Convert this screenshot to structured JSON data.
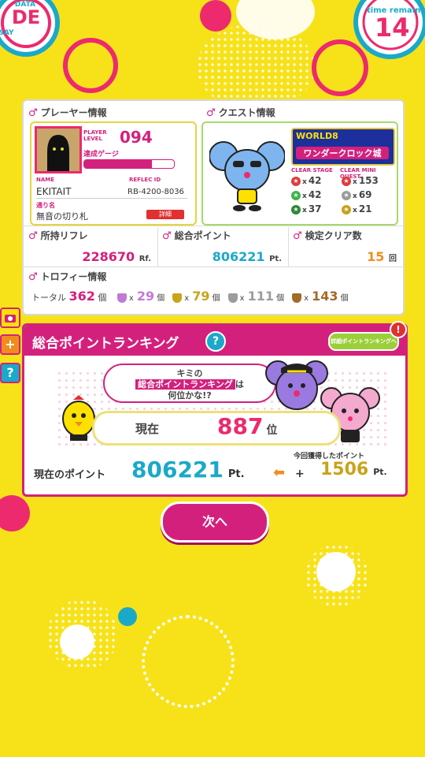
{
  "header": {
    "logo_text": "DATA SAY DE",
    "time_label": "time remain",
    "time_value": "14"
  },
  "player": {
    "section_title": "プレーヤー情報",
    "level_label": "PLAYER LEVEL",
    "level": "094",
    "gauge_label": "達成ゲージ",
    "gauge_fraction": 0.75,
    "name_label": "NAME",
    "name": "EKITAIT",
    "reflec_label": "REFLEC ID",
    "reflec_id": "RB-4200-8036",
    "alias_label": "通り名",
    "alias": "無音の切り札",
    "change_button": "詳細"
  },
  "quest": {
    "section_title": "クエスト情報",
    "world": "WORLD8",
    "castle": "ワンダークロック城",
    "clear_stage_label": "CLEAR STAGE",
    "clear_mini_label": "CLEAR MINI QUEST",
    "stages": [
      {
        "color": "#e03c3c",
        "count": "42"
      },
      {
        "color": "#3cb44b",
        "count": "42"
      },
      {
        "color": "#2a8a35",
        "count": "37"
      }
    ],
    "minis": [
      {
        "color": "#e03c3c",
        "count": "153"
      },
      {
        "color": "#9a9a9a",
        "count": "69"
      },
      {
        "color": "#c8a21a",
        "count": "21"
      }
    ]
  },
  "stats": {
    "reflec_label": "所持リフレ",
    "reflec_value": "228670",
    "reflec_unit": "Rf.",
    "points_label": "総合ポイント",
    "points_value": "806221",
    "points_unit": "Pt.",
    "clear_label": "検定クリア数",
    "clear_value": "15",
    "clear_unit": "回"
  },
  "trophy": {
    "section_title": "トロフィー情報",
    "total_label": "トータル",
    "total": "362",
    "unit": "個",
    "x": "x",
    "items": [
      {
        "color": "#c07ad6",
        "count": "29"
      },
      {
        "color": "#c9a31b",
        "count": "79"
      },
      {
        "color": "#9c9c9c",
        "count": "111"
      },
      {
        "color": "#a46a28",
        "count": "143"
      }
    ]
  },
  "ranking": {
    "title": "総合ポイントランキング",
    "detail_button": "詳細ポイントランキングへ",
    "bubble_line1": "キミの",
    "bubble_line2": "総合ポイントランキング",
    "bubble_line2b": "は",
    "bubble_line3": "何位かな!?",
    "current_label": "現在",
    "rank": "887",
    "rank_unit": "位",
    "points_label": "現在のポイント",
    "points": "806221",
    "points_unit": "Pt.",
    "gained_label": "今回獲得したポイント",
    "gained": "1506",
    "gained_unit": "Pt.",
    "plus": "+"
  },
  "next_button": "次へ",
  "sidebar": {
    "plus": "+",
    "question": "?"
  }
}
